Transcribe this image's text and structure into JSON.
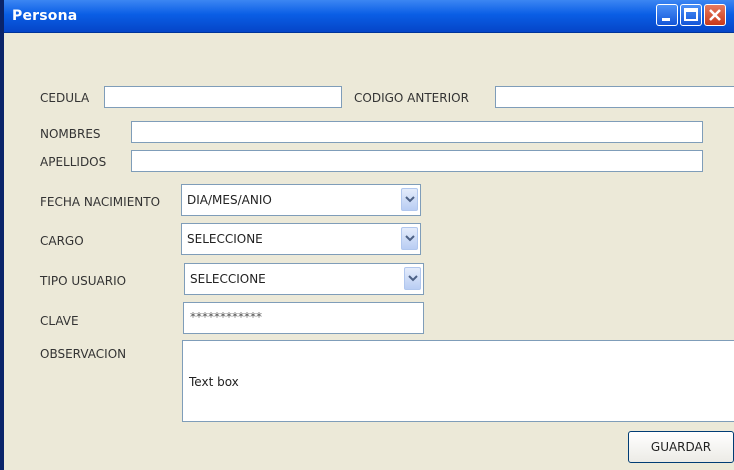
{
  "window": {
    "title": "Persona"
  },
  "form": {
    "cedula_label": "CEDULA",
    "cedula_value": "",
    "codigo_anterior_label": "CODIGO ANTERIOR",
    "codigo_anterior_value": "",
    "nombres_label": "NOMBRES",
    "nombres_value": "",
    "apellidos_label": "APELLIDOS",
    "apellidos_value": "",
    "fecha_nacimiento_label": "FECHA NACIMIENTO",
    "fecha_nacimiento_value": "DIA/MES/ANIO",
    "cargo_label": "CARGO",
    "cargo_value": "SELECCIONE",
    "tipo_usuario_label": "TIPO USUARIO",
    "tipo_usuario_value": "SELECCIONE",
    "clave_label": "CLAVE",
    "clave_value": "************",
    "observacion_label": "OBSERVACION",
    "observacion_value": "Text box"
  },
  "actions": {
    "guardar_label": "GUARDAR"
  },
  "colors": {
    "titlebar": "#0a5ee5",
    "body": "#ece9d8",
    "input_border": "#7f9db9"
  }
}
